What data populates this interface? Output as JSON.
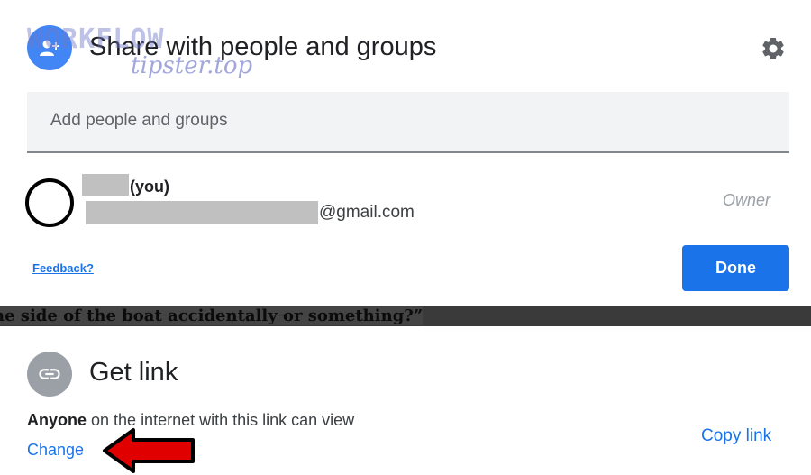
{
  "share_dialog": {
    "title": "Share with people and groups",
    "watermark": "WORKFLOW",
    "watermark_url": "tipster.top",
    "input_placeholder": "Add people and groups",
    "user": {
      "you_label": "(you)",
      "email_suffix": "@gmail.com",
      "role": "Owner"
    },
    "feedback_label": "Feedback?",
    "done_label": "Done",
    "icons": {
      "add_person": "person-add-icon",
      "settings": "gear-icon"
    },
    "colors": {
      "accent": "#1a73e8",
      "avatar": "#4285f4"
    }
  },
  "background_text": "ne side of the boat accidentally or something?”",
  "get_link": {
    "title": "Get link",
    "access_bold": "Anyone",
    "access_rest": " on the internet with this link can view",
    "change_label": "Change",
    "copy_label": "Copy link",
    "icons": {
      "link": "link-icon",
      "annotation": "red-arrow-annotation"
    },
    "colors": {
      "icon_bg": "#9aa0a6",
      "annotation": "#e00000"
    }
  }
}
